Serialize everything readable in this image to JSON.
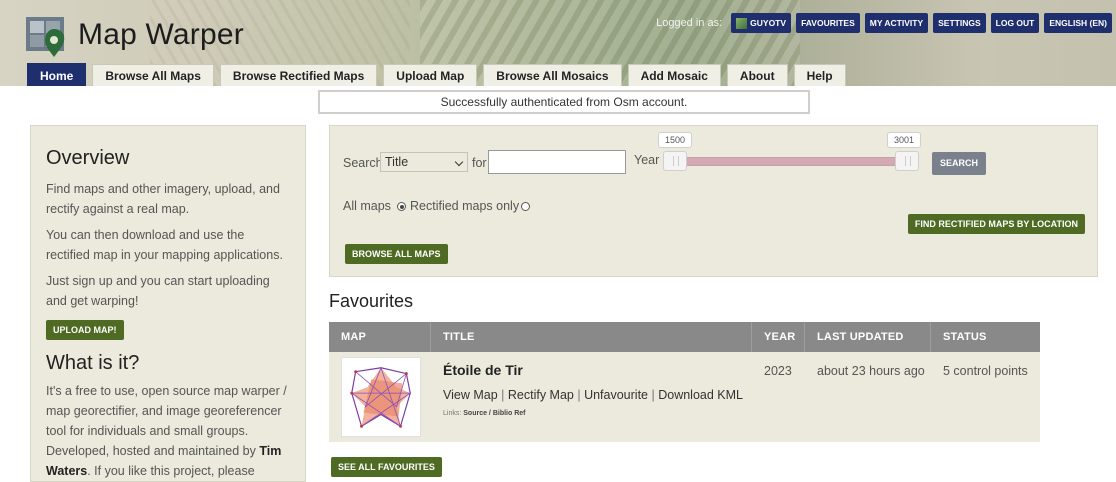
{
  "header": {
    "site_title": "Map Warper",
    "logged_in_label": "Logged in as:",
    "user_buttons": [
      "GUYOTV",
      "FAVOURITES",
      "MY ACTIVITY",
      "SETTINGS",
      "LOG OUT",
      "ENGLISH (EN)"
    ]
  },
  "tabs": [
    "Home",
    "Browse All Maps",
    "Browse Rectified Maps",
    "Upload Map",
    "Browse All Mosaics",
    "Add Mosaic",
    "About",
    "Help"
  ],
  "flash": "Successfully authenticated from Osm account.",
  "sidebar": {
    "overview_title": "Overview",
    "p1": "Find maps and other imagery, upload, and rectify against a real map.",
    "p2": "You can then download and use the rectified map in your mapping applications.",
    "p3": "Just sign up and you can start uploading and get warping!",
    "upload_btn": "UPLOAD MAP!",
    "what_title": "What is it?",
    "p4_a": "It's a free to use, open source map warper / map georectifier, and image georeferencer tool for individuals and small groups. Developed, hosted and maintained by ",
    "p4_name1": "Tim",
    "p4_name2": "Waters",
    "p4_b": ". If you like this project, please"
  },
  "search": {
    "label": "Search",
    "field_selected": "Title",
    "for_label": "for",
    "query_value": "",
    "year_label": "Year",
    "year_min": "1500",
    "year_max": "3001",
    "search_btn": "SEARCH",
    "all_maps_label": "All maps",
    "rectified_only_label": "Rectified maps only",
    "find_btn": "FIND RECTIFIED MAPS BY LOCATION",
    "browse_btn": "BROWSE ALL MAPS"
  },
  "favourites": {
    "title": "Favourites",
    "columns": [
      "MAP",
      "TITLE",
      "YEAR",
      "LAST UPDATED",
      "STATUS"
    ],
    "rows": [
      {
        "title": "Étoile de Tir",
        "links": [
          "View Map",
          "Rectify Map",
          "Unfavourite",
          "Download KML"
        ],
        "small_prefix": "Links:",
        "small_links": "Source / Biblio Ref",
        "year": "2023",
        "updated": "about 23 hours ago",
        "status": "5 control points"
      }
    ],
    "see_all_btn": "SEE ALL FAVOURITES"
  },
  "colors": {
    "nav_blue": "#1f2f6e",
    "green": "#4e6a23",
    "panel": "#ebeadc",
    "table_header": "#898989",
    "slider": "#d4aab2"
  }
}
